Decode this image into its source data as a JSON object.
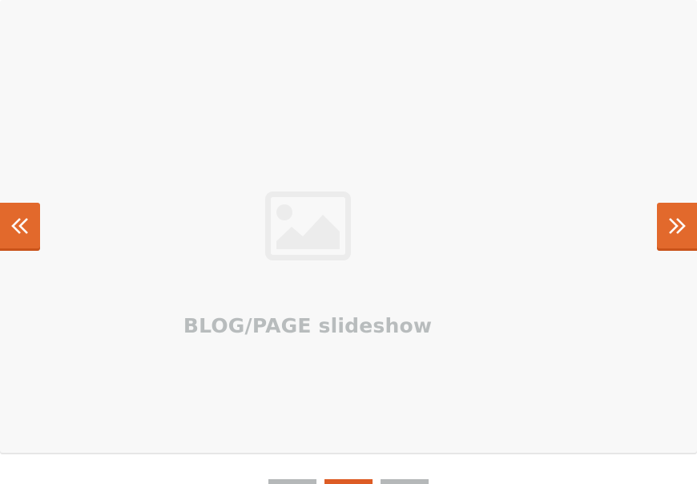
{
  "slideshow": {
    "caption": "BLOG/PAGE slideshow",
    "image_icon": "image-placeholder-icon",
    "prev_icon": "double-chevron-left-icon",
    "next_icon": "double-chevron-right-icon",
    "active_slide": 2,
    "slide_count": 3
  },
  "colors": {
    "accent": "#e2692c",
    "accent_dark": "#c9531a",
    "slide_background": "#f8f8f8",
    "caption_text": "#b8bcbd",
    "placeholder_icon": "#ececec",
    "pager_inactive": "#b5b8b9",
    "pager_active": "#dd5c25"
  }
}
